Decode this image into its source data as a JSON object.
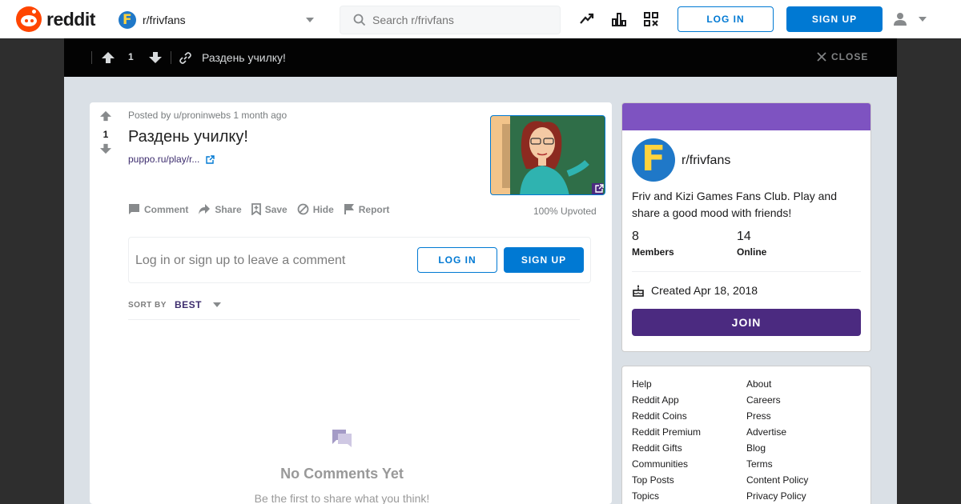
{
  "header": {
    "logo_text": "reddit",
    "subreddit": "r/frivfans",
    "search_placeholder": "Search r/frivfans",
    "login_label": "LOG IN",
    "signup_label": "SIGN UP"
  },
  "postbar": {
    "votes": "1",
    "title": "Раздень училку!",
    "close_label": "CLOSE"
  },
  "post": {
    "votes": "1",
    "posted_by": "Posted by u/proninwebs 1 month ago",
    "title": "Раздень училку!",
    "link": "puppo.ru/play/r...",
    "actions": {
      "comment": "Comment",
      "share": "Share",
      "save": "Save",
      "hide": "Hide",
      "report": "Report"
    },
    "upvoted": "100% Upvoted",
    "comment_prompt": "Log in or sign up to leave a comment",
    "login_label": "LOG IN",
    "signup_label": "SIGN UP",
    "sort_label": "SORT BY",
    "sort_value": "BEST",
    "empty_title": "No Comments Yet",
    "empty_sub": "Be the first to share what you think!"
  },
  "community": {
    "name": "r/frivfans",
    "description": "Friv and Kizi Games Fans Club. Play and share a good mood with friends!",
    "members_count": "8",
    "members_label": "Members",
    "online_count": "14",
    "online_label": "Online",
    "created": "Created Apr 18, 2018",
    "join_label": "JOIN"
  },
  "footer_links": {
    "left": [
      "Help",
      "Reddit App",
      "Reddit Coins",
      "Reddit Premium",
      "Reddit Gifts",
      "Communities",
      "Top Posts",
      "Topics"
    ],
    "right": [
      "About",
      "Careers",
      "Press",
      "Advertise",
      "Blog",
      "Terms",
      "Content Policy",
      "Privacy Policy"
    ]
  },
  "colors": {
    "brand": "#ff4500",
    "accent": "#0079d3",
    "community_banner": "#7e53c1",
    "join_button": "#4b2a80"
  }
}
